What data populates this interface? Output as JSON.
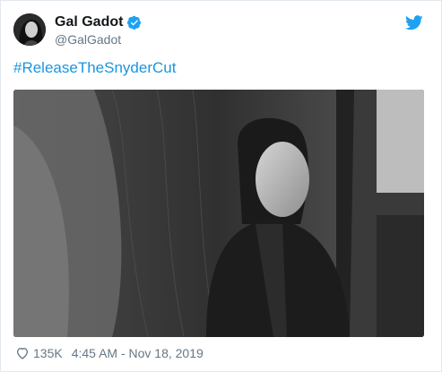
{
  "user": {
    "name": "Gal Gadot",
    "handle": "@GalGadot",
    "verified_icon": "verified-badge-icon",
    "avatar_icon": "profile-avatar"
  },
  "tweet": {
    "text": "#ReleaseTheSnyderCut",
    "photo_icon": "black-and-white-portrait-photo"
  },
  "footer": {
    "likes": "135K",
    "timestamp": "4:45 AM - Nov 18, 2019"
  },
  "colors": {
    "link": "#1b95e0",
    "name": "#14171a",
    "meta": "#657786",
    "twitter_bird": "#1da1f2"
  }
}
